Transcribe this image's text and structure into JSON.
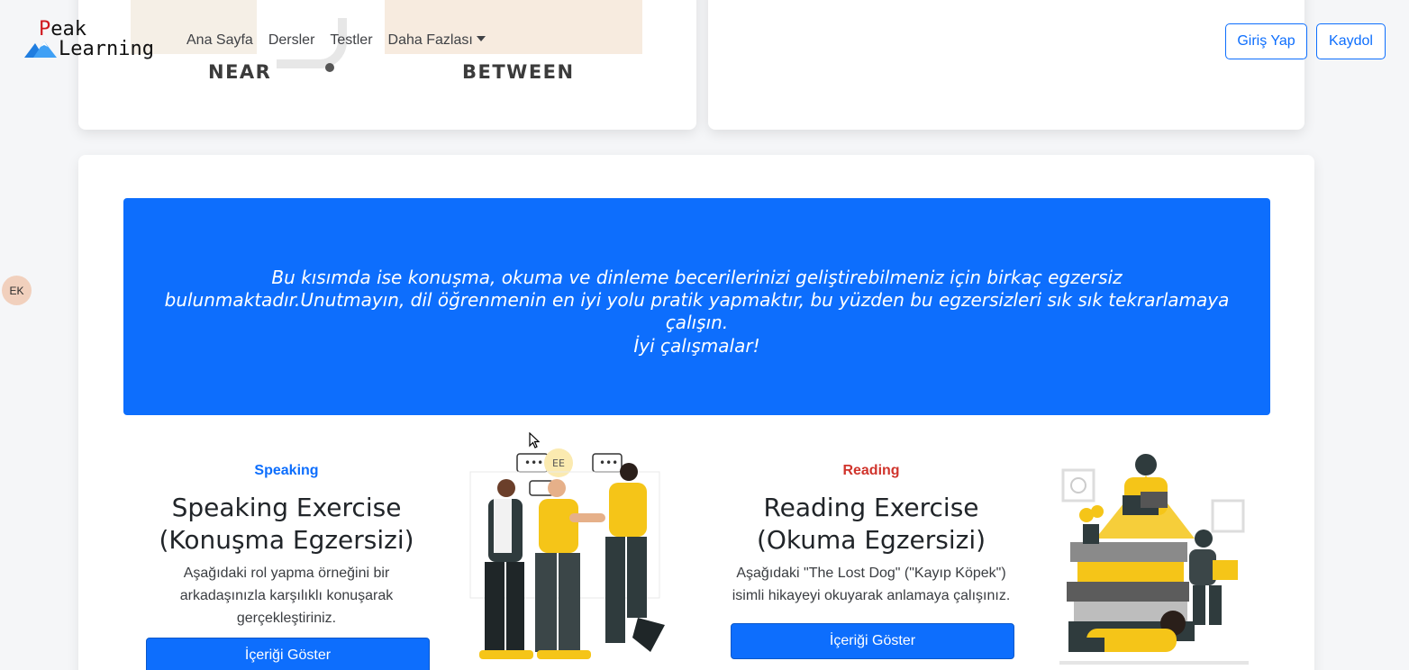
{
  "nav": {
    "logo_line1_first": "P",
    "logo_line1_rest": "eak",
    "logo_line2": "Learning",
    "links": [
      "Ana Sayfa",
      "Dersler",
      "Testler",
      "Daha Fazlası"
    ],
    "login_label": "Giriş Yap",
    "signup_label": "Kaydol"
  },
  "top_cards": {
    "word_left": "NEAR",
    "word_right": "BETWEEN"
  },
  "avatar": {
    "initials": "EK"
  },
  "banner": {
    "text": "Bu kısımda ise konuşma, okuma ve dinleme becerilerinizi geliştirebilmeniz için birkaç egzersiz bulunmaktadır.Unutmayın, dil öğrenmenin en iyi yolu pratik yapmaktır, bu yüzden bu egzersizleri sık sık tekrarlamaya çalışın.",
    "closing": "İyi çalışmalar!"
  },
  "exercises": [
    {
      "label": "Speaking",
      "title": "Speaking Exercise (Konuşma Egzersizi)",
      "description": "Aşağıdaki rol yapma örneğini bir arkadaşınızla karşılıklı konuşarak gerçekleştiriniz.",
      "button": "İçeriği Göster",
      "badge": "EE"
    },
    {
      "label": "Reading",
      "title": "Reading Exercise (Okuma Egzersizi)",
      "description": "Aşağıdaki \"The Lost Dog\" (\"Kayıp Köpek\") isimli hikayeyi okuyarak anlamaya çalışınız.",
      "button": "İçeriği Göster"
    }
  ],
  "colors": {
    "primary": "#0d6efd",
    "reading_label": "#d0342c",
    "illustration_yellow": "#f5c518",
    "illustration_dark": "#2f3b3d"
  }
}
